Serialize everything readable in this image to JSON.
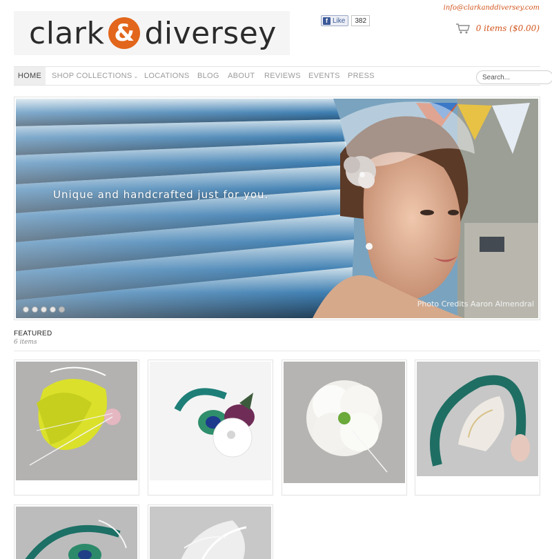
{
  "header": {
    "logo_text_left": "clark",
    "logo_amp": "&",
    "logo_text_right": "diversey",
    "email": "info@clarkanddiversey.com",
    "facebook": {
      "like_label": "Like",
      "like_count": "382"
    },
    "cart": {
      "icon": "cart-icon",
      "summary": "0 items ($0.00)"
    }
  },
  "nav": {
    "items": [
      {
        "label": "HOME",
        "active": true
      },
      {
        "label": "SHOP COLLECTIONS",
        "has_dropdown": true
      },
      {
        "label": "LOCATIONS"
      },
      {
        "label": "BLOG"
      },
      {
        "label": "ABOUT"
      },
      {
        "label": "REVIEWS"
      },
      {
        "label": "EVENTS"
      },
      {
        "label": "PRESS"
      }
    ],
    "search": {
      "placeholder": "Search..."
    }
  },
  "hero": {
    "tagline": "Unique and handcrafted just for you.",
    "credit": "Photo Credits Aaron Almendral",
    "slide_count": 5,
    "active_slide": 5
  },
  "featured": {
    "title": "FEATURED",
    "count": "6 items"
  },
  "colors": {
    "accent": "#e2661b",
    "link": "#d2561e",
    "nav_text": "#9a9a9a"
  }
}
